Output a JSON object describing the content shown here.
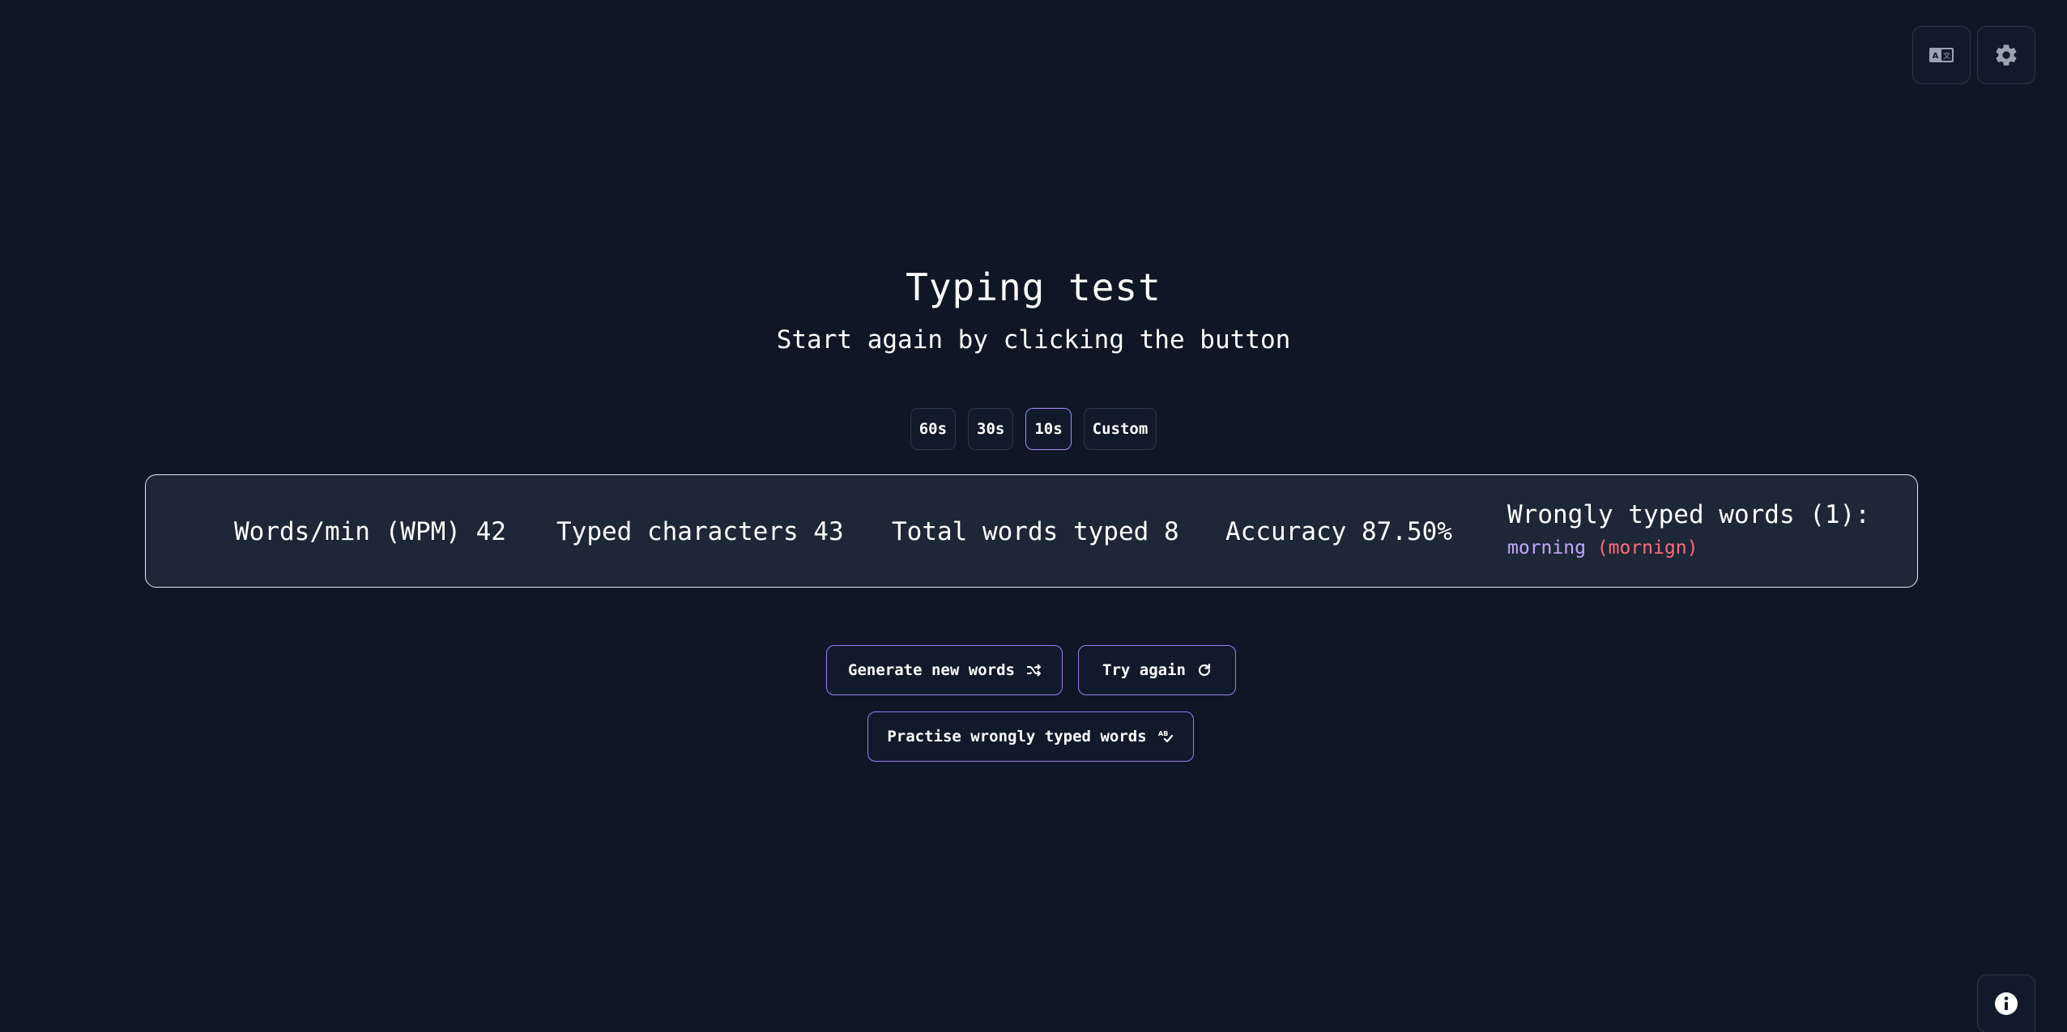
{
  "header": {
    "language_button_icon": "language-icon",
    "settings_button_icon": "gear-icon"
  },
  "main": {
    "title": "Typing test",
    "subtitle": "Start again by clicking the button"
  },
  "durations": [
    {
      "label": "60s",
      "active": false
    },
    {
      "label": "30s",
      "active": false
    },
    {
      "label": "10s",
      "active": true
    },
    {
      "label": "Custom",
      "active": false
    }
  ],
  "stats": {
    "wpm": "Words/min (WPM) 42",
    "typed_characters": "Typed characters 43",
    "total_words": "Total words typed 8",
    "accuracy": "Accuracy 87.50%",
    "wrong_words_title": "Wrongly typed words (1):",
    "wrong_words": [
      {
        "correct": "morning",
        "typed": "(mornign)"
      }
    ]
  },
  "actions": {
    "generate_label": "Generate new words",
    "try_again_label": "Try again",
    "practise_label": "Practise wrongly typed words"
  },
  "footer": {
    "info_button_icon": "info-icon"
  },
  "colors": {
    "background": "#0f1727",
    "panel": "#1e2737",
    "accent": "#a98bf5",
    "correct_word": "#c3a8ff",
    "typed_wrong": "#ff6b7a"
  }
}
